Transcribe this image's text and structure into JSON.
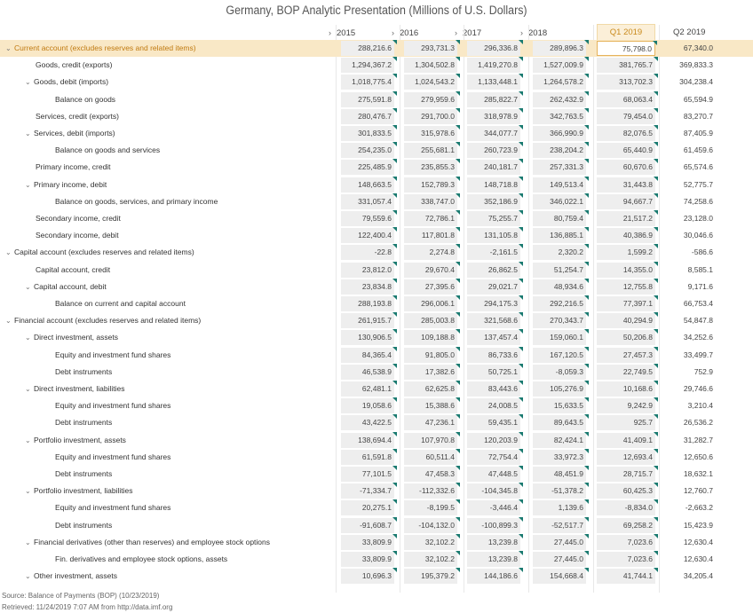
{
  "title": "Germany, BOP Analytic Presentation (Millions of U.S. Dollars)",
  "columns": [
    {
      "label": "2015",
      "expand": "›"
    },
    {
      "label": "2016",
      "expand": "›"
    },
    {
      "label": "2017",
      "expand": "›"
    },
    {
      "label": "2018",
      "expand": "›"
    },
    {
      "label": "Q1 2019",
      "expand": ""
    },
    {
      "label": "Q2 2019",
      "expand": ""
    }
  ],
  "rows": [
    {
      "label": "Current account (excludes reserves and related items)",
      "level": 0,
      "expanded": true,
      "selected": true,
      "values": [
        "288,216.6",
        "293,731.3",
        "296,336.8",
        "289,896.3",
        "75,798.0",
        "67,340.0"
      ]
    },
    {
      "label": "Goods, credit (exports)",
      "level": 1,
      "expanded": false,
      "values": [
        "1,294,367.2",
        "1,304,502.8",
        "1,419,270.8",
        "1,527,009.9",
        "381,765.7",
        "369,833.3"
      ]
    },
    {
      "label": "Goods, debit (imports)",
      "level": 1,
      "expanded": true,
      "values": [
        "1,018,775.4",
        "1,024,543.2",
        "1,133,448.1",
        "1,264,578.2",
        "313,702.3",
        "304,238.4"
      ]
    },
    {
      "label": "Balance on goods",
      "level": 2,
      "expanded": false,
      "values": [
        "275,591.8",
        "279,959.6",
        "285,822.7",
        "262,432.9",
        "68,063.4",
        "65,594.9"
      ]
    },
    {
      "label": "Services, credit (exports)",
      "level": 1,
      "expanded": false,
      "values": [
        "280,476.7",
        "291,700.0",
        "318,978.9",
        "342,763.5",
        "79,454.0",
        "83,270.7"
      ]
    },
    {
      "label": "Services, debit (imports)",
      "level": 1,
      "expanded": true,
      "values": [
        "301,833.5",
        "315,978.6",
        "344,077.7",
        "366,990.9",
        "82,076.5",
        "87,405.9"
      ]
    },
    {
      "label": "Balance on goods and services",
      "level": 2,
      "expanded": false,
      "values": [
        "254,235.0",
        "255,681.1",
        "260,723.9",
        "238,204.2",
        "65,440.9",
        "61,459.6"
      ]
    },
    {
      "label": "Primary income, credit",
      "level": 1,
      "expanded": false,
      "values": [
        "225,485.9",
        "235,855.3",
        "240,181.7",
        "257,331.3",
        "60,670.6",
        "65,574.6"
      ]
    },
    {
      "label": "Primary income, debit",
      "level": 1,
      "expanded": true,
      "values": [
        "148,663.5",
        "152,789.3",
        "148,718.8",
        "149,513.4",
        "31,443.8",
        "52,775.7"
      ]
    },
    {
      "label": "Balance on goods, services, and primary income",
      "level": 2,
      "expanded": false,
      "values": [
        "331,057.4",
        "338,747.0",
        "352,186.9",
        "346,022.1",
        "94,667.7",
        "74,258.6"
      ]
    },
    {
      "label": "Secondary income, credit",
      "level": 1,
      "expanded": false,
      "values": [
        "79,559.6",
        "72,786.1",
        "75,255.7",
        "80,759.4",
        "21,517.2",
        "23,128.0"
      ]
    },
    {
      "label": "Secondary income, debit",
      "level": 1,
      "expanded": false,
      "values": [
        "122,400.4",
        "117,801.8",
        "131,105.8",
        "136,885.1",
        "40,386.9",
        "30,046.6"
      ]
    },
    {
      "label": "Capital account (excludes reserves and related items)",
      "level": 0,
      "expanded": true,
      "values": [
        "-22.8",
        "2,274.8",
        "-2,161.5",
        "2,320.2",
        "1,599.2",
        "-586.6"
      ]
    },
    {
      "label": "Capital account, credit",
      "level": 1,
      "expanded": false,
      "values": [
        "23,812.0",
        "29,670.4",
        "26,862.5",
        "51,254.7",
        "14,355.0",
        "8,585.1"
      ]
    },
    {
      "label": "Capital account, debit",
      "level": 1,
      "expanded": true,
      "values": [
        "23,834.8",
        "27,395.6",
        "29,021.7",
        "48,934.6",
        "12,755.8",
        "9,171.6"
      ]
    },
    {
      "label": "Balance on current and capital account",
      "level": 2,
      "expanded": false,
      "values": [
        "288,193.8",
        "296,006.1",
        "294,175.3",
        "292,216.5",
        "77,397.1",
        "66,753.4"
      ]
    },
    {
      "label": "Financial account (excludes reserves and related items)",
      "level": 0,
      "expanded": true,
      "values": [
        "261,915.7",
        "285,003.8",
        "321,568.6",
        "270,343.7",
        "40,294.9",
        "54,847.8"
      ]
    },
    {
      "label": "Direct investment, assets",
      "level": 1,
      "expanded": true,
      "values": [
        "130,906.5",
        "109,188.8",
        "137,457.4",
        "159,060.1",
        "50,206.8",
        "34,252.6"
      ]
    },
    {
      "label": "Equity and investment fund shares",
      "level": 2,
      "expanded": false,
      "values": [
        "84,365.4",
        "91,805.0",
        "86,733.6",
        "167,120.5",
        "27,457.3",
        "33,499.7"
      ]
    },
    {
      "label": "Debt instruments",
      "level": 2,
      "expanded": false,
      "values": [
        "46,538.9",
        "17,382.6",
        "50,725.1",
        "-8,059.3",
        "22,749.5",
        "752.9"
      ]
    },
    {
      "label": "Direct investment, liabilities",
      "level": 1,
      "expanded": true,
      "values": [
        "62,481.1",
        "62,625.8",
        "83,443.6",
        "105,276.9",
        "10,168.6",
        "29,746.6"
      ]
    },
    {
      "label": "Equity and investment fund shares",
      "level": 2,
      "expanded": false,
      "values": [
        "19,058.6",
        "15,388.6",
        "24,008.5",
        "15,633.5",
        "9,242.9",
        "3,210.4"
      ]
    },
    {
      "label": "Debt instruments",
      "level": 2,
      "expanded": false,
      "values": [
        "43,422.5",
        "47,236.1",
        "59,435.1",
        "89,643.5",
        "925.7",
        "26,536.2"
      ]
    },
    {
      "label": "Portfolio investment, assets",
      "level": 1,
      "expanded": true,
      "values": [
        "138,694.4",
        "107,970.8",
        "120,203.9",
        "82,424.1",
        "41,409.1",
        "31,282.7"
      ]
    },
    {
      "label": "Equity and investment fund shares",
      "level": 2,
      "expanded": false,
      "values": [
        "61,591.8",
        "60,511.4",
        "72,754.4",
        "33,972.3",
        "12,693.4",
        "12,650.6"
      ]
    },
    {
      "label": "Debt instruments",
      "level": 2,
      "expanded": false,
      "values": [
        "77,101.5",
        "47,458.3",
        "47,448.5",
        "48,451.9",
        "28,715.7",
        "18,632.1"
      ]
    },
    {
      "label": "Portfolio investment, liabilities",
      "level": 1,
      "expanded": true,
      "values": [
        "-71,334.7",
        "-112,332.6",
        "-104,345.8",
        "-51,378.2",
        "60,425.3",
        "12,760.7"
      ]
    },
    {
      "label": "Equity and investment fund shares",
      "level": 2,
      "expanded": false,
      "values": [
        "20,275.1",
        "-8,199.5",
        "-3,446.4",
        "1,139.6",
        "-8,834.0",
        "-2,663.2"
      ]
    },
    {
      "label": "Debt instruments",
      "level": 2,
      "expanded": false,
      "values": [
        "-91,608.7",
        "-104,132.0",
        "-100,899.3",
        "-52,517.7",
        "69,258.2",
        "15,423.9"
      ]
    },
    {
      "label": "Financial derivatives (other than reserves) and employee stock options",
      "level": 1,
      "expanded": true,
      "values": [
        "33,809.9",
        "32,102.2",
        "13,239.8",
        "27,445.0",
        "7,023.6",
        "12,630.4"
      ]
    },
    {
      "label": "Fin. derivatives and employee stock options, assets",
      "level": 2,
      "expanded": false,
      "values": [
        "33,809.9",
        "32,102.2",
        "13,239.8",
        "27,445.0",
        "7,023.6",
        "12,630.4"
      ]
    },
    {
      "label": "Other investment, assets",
      "level": 1,
      "expanded": true,
      "values": [
        "10,696.3",
        "195,379.2",
        "144,186.6",
        "154,668.4",
        "41,744.1",
        "34,205.4"
      ]
    }
  ],
  "footer": {
    "source": "Source: Balance of Payments (BOP) (10/23/2019)",
    "retrieved": "Retrieved: 11/24/2019 7:07 AM from http://data.imf.org"
  },
  "colors": {
    "selected_row": "#f9e8c6",
    "selected_text": "#c07a10",
    "header_highlight": "#fbefd8",
    "cell_shade": "#eeeeee",
    "flag_marker": "#1a7a70"
  }
}
